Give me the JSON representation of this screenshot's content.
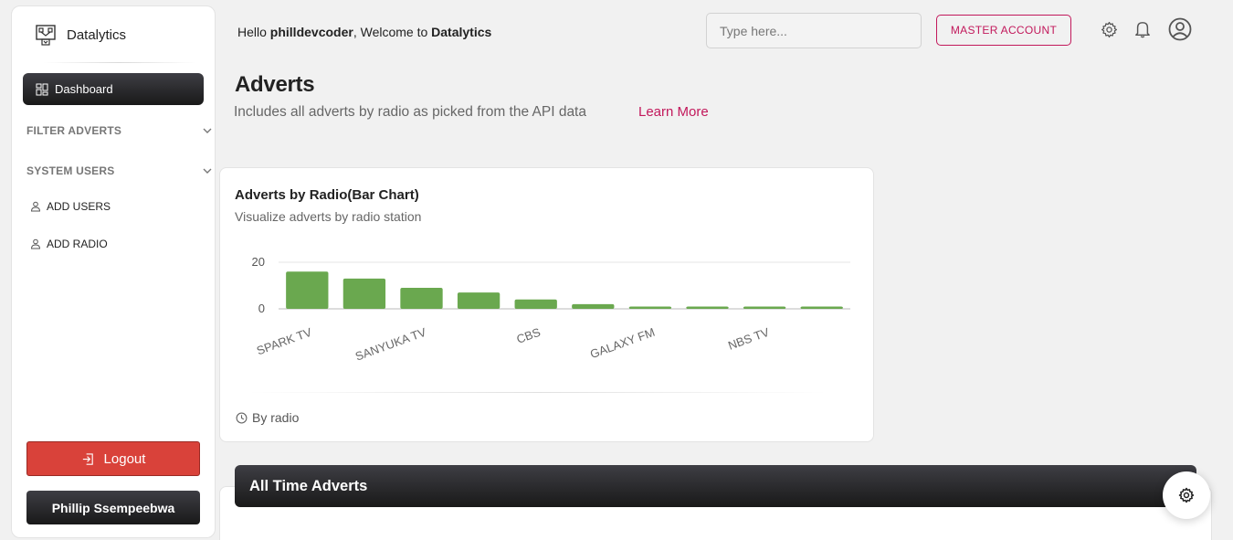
{
  "brand": {
    "name": "Datalytics"
  },
  "sidebar": {
    "active_item": "Dashboard",
    "sections": [
      {
        "label": "FILTER ADVERTS"
      },
      {
        "label": "SYSTEM USERS"
      }
    ],
    "sub_items": [
      {
        "label": "ADD USERS",
        "icon": "user-icon"
      },
      {
        "label": "ADD RADIO",
        "icon": "user-icon"
      }
    ],
    "logout_label": "Logout",
    "user_name": "Phillip Ssempeebwa"
  },
  "header": {
    "greeting_prefix": "Hello",
    "username": "philldevcoder",
    "greeting_middle": ", Welcome to",
    "app_name": "Datalytics",
    "search_placeholder": "Type here...",
    "master_account_label": "MASTER ACCOUNT",
    "icons": [
      "gear-icon",
      "bell-icon",
      "account-circle-icon"
    ]
  },
  "page": {
    "title": "Adverts",
    "subtitle": "Includes all adverts by radio as picked from the API data",
    "learn_more": "Learn More"
  },
  "chart_card": {
    "title": "Adverts by Radio(Bar Chart)",
    "subtitle": "Visualize adverts by radio station",
    "footer": "By radio"
  },
  "chart_data": {
    "type": "bar",
    "categories": [
      "SPARK TV",
      "",
      "SANYUKA TV",
      "",
      "CBS",
      "",
      "GALAXY FM",
      "",
      "NBS TV",
      ""
    ],
    "tick_labels_shown": [
      "SPARK TV",
      "SANYUKA TV",
      "CBS",
      "GALAXY FM",
      "NBS TV"
    ],
    "values": [
      16,
      13,
      9,
      7,
      4,
      2,
      1,
      1,
      1,
      1
    ],
    "ylim": [
      0,
      20
    ],
    "yticks": [
      0,
      20
    ],
    "grid": true,
    "color": "#6aa84f"
  },
  "all_time_card": {
    "title": "All Time Adverts"
  },
  "colors": {
    "accent": "#c2185b",
    "logout": "#d9423a",
    "bar": "#6aa84f",
    "dark": "#191919"
  }
}
